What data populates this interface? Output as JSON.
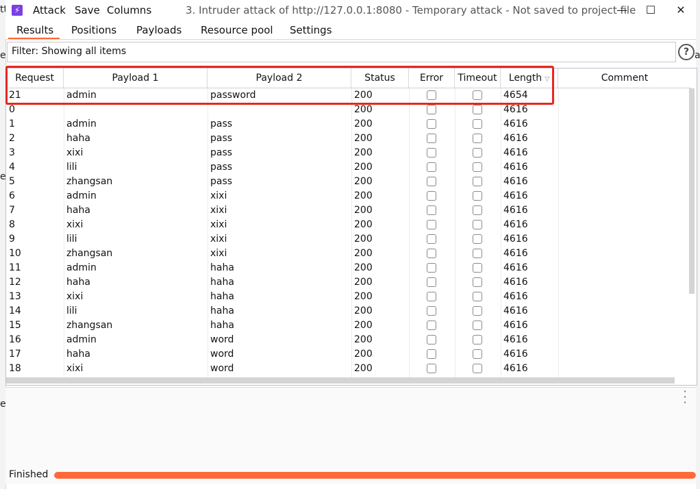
{
  "window": {
    "menu": [
      "Attack",
      "Save",
      "Columns"
    ],
    "title": "3. Intruder attack of http://127.0.0.1:8080 - Temporary attack - Not saved to project file",
    "controls": [
      "—",
      "☐",
      "✕"
    ]
  },
  "tabs": [
    {
      "label": "Results",
      "active": true
    },
    {
      "label": "Positions",
      "active": false
    },
    {
      "label": "Payloads",
      "active": false
    },
    {
      "label": "Resource pool",
      "active": false
    },
    {
      "label": "Settings",
      "active": false
    }
  ],
  "filter": {
    "text": "Filter: Showing all items",
    "help": "?"
  },
  "table": {
    "columns": [
      "Request",
      "Payload 1",
      "Payload 2",
      "Status",
      "Error",
      "Timeout",
      "Length",
      "Comment"
    ],
    "rows": [
      {
        "request": "21",
        "p1": "admin",
        "p2": "password",
        "status": "200",
        "length": "4654"
      },
      {
        "request": "0",
        "p1": "",
        "p2": "",
        "status": "200",
        "length": "4616"
      },
      {
        "request": "1",
        "p1": "admin",
        "p2": "pass",
        "status": "200",
        "length": "4616"
      },
      {
        "request": "2",
        "p1": "haha",
        "p2": "pass",
        "status": "200",
        "length": "4616"
      },
      {
        "request": "3",
        "p1": "xixi",
        "p2": "pass",
        "status": "200",
        "length": "4616"
      },
      {
        "request": "4",
        "p1": "lili",
        "p2": "pass",
        "status": "200",
        "length": "4616"
      },
      {
        "request": "5",
        "p1": "zhangsan",
        "p2": "pass",
        "status": "200",
        "length": "4616"
      },
      {
        "request": "6",
        "p1": "admin",
        "p2": "xixi",
        "status": "200",
        "length": "4616"
      },
      {
        "request": "7",
        "p1": "haha",
        "p2": "xixi",
        "status": "200",
        "length": "4616"
      },
      {
        "request": "8",
        "p1": "xixi",
        "p2": "xixi",
        "status": "200",
        "length": "4616"
      },
      {
        "request": "9",
        "p1": "lili",
        "p2": "xixi",
        "status": "200",
        "length": "4616"
      },
      {
        "request": "10",
        "p1": "zhangsan",
        "p2": "xixi",
        "status": "200",
        "length": "4616"
      },
      {
        "request": "11",
        "p1": "admin",
        "p2": "haha",
        "status": "200",
        "length": "4616"
      },
      {
        "request": "12",
        "p1": "haha",
        "p2": "haha",
        "status": "200",
        "length": "4616"
      },
      {
        "request": "13",
        "p1": "xixi",
        "p2": "haha",
        "status": "200",
        "length": "4616"
      },
      {
        "request": "14",
        "p1": "lili",
        "p2": "haha",
        "status": "200",
        "length": "4616"
      },
      {
        "request": "15",
        "p1": "zhangsan",
        "p2": "haha",
        "status": "200",
        "length": "4616"
      },
      {
        "request": "16",
        "p1": "admin",
        "p2": "word",
        "status": "200",
        "length": "4616"
      },
      {
        "request": "17",
        "p1": "haha",
        "p2": "word",
        "status": "200",
        "length": "4616"
      },
      {
        "request": "18",
        "p1": "xixi",
        "p2": "word",
        "status": "200",
        "length": "4616"
      }
    ]
  },
  "status": {
    "text": "Finished",
    "progress": 1.0
  },
  "background_fragments": [
    "tt",
    "e",
    "e",
    "e",
    "a"
  ],
  "colors": {
    "accent": "#ff6633",
    "highlight": "#e8261f",
    "progress": "#ff6a3a",
    "logo": "#7b3fe4"
  }
}
